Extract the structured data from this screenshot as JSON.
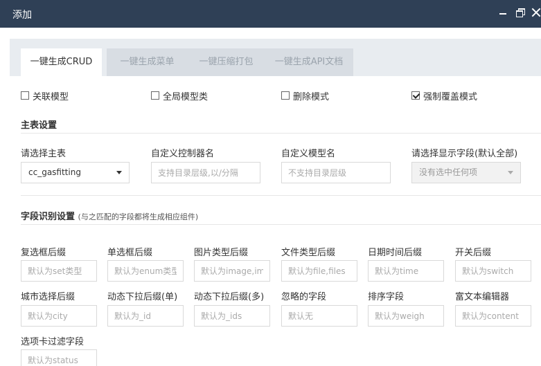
{
  "window": {
    "title": "添加"
  },
  "tabs": [
    {
      "label": "一键生成CRUD",
      "active": true
    },
    {
      "label": "一键生成菜单",
      "active": false
    },
    {
      "label": "一键压缩打包",
      "active": false
    },
    {
      "label": "一键生成API文档",
      "active": false
    }
  ],
  "options": [
    {
      "label": "关联模型",
      "checked": false
    },
    {
      "label": "全局模型类",
      "checked": false
    },
    {
      "label": "删除模式",
      "checked": false
    },
    {
      "label": "强制覆盖模式",
      "checked": true
    }
  ],
  "main_table_section": {
    "title": "主表设置",
    "main_table": {
      "label": "请选择主表",
      "value": "cc_gasfitting"
    },
    "controller": {
      "label": "自定义控制器名",
      "placeholder": "支持目录层级,以/分隔"
    },
    "model": {
      "label": "自定义模型名",
      "placeholder": "不支持目录层级"
    },
    "display_fields": {
      "label": "请选择显示字段(默认全部)",
      "value": "没有选中任何项"
    }
  },
  "field_section": {
    "title": "字段识别设置",
    "note": "(与之匹配的字段都将生成相应组件)",
    "fields": [
      {
        "label": "复选框后缀",
        "placeholder": "默认为set类型"
      },
      {
        "label": "单选框后缀",
        "placeholder": "默认为enum类型"
      },
      {
        "label": "图片类型后缀",
        "placeholder": "默认为image,images"
      },
      {
        "label": "文件类型后缀",
        "placeholder": "默认为file,files"
      },
      {
        "label": "日期时间后缀",
        "placeholder": "默认为time"
      },
      {
        "label": "开关后缀",
        "placeholder": "默认为switch"
      },
      {
        "label": "城市选择后缀",
        "placeholder": "默认为city"
      },
      {
        "label": "动态下拉后缀(单)",
        "placeholder": "默认为_id"
      },
      {
        "label": "动态下拉后缀(多)",
        "placeholder": "默认为_ids"
      },
      {
        "label": "忽略的字段",
        "placeholder": "默认无"
      },
      {
        "label": "排序字段",
        "placeholder": "默认为weigh"
      },
      {
        "label": "富文本编辑器",
        "placeholder": "默认为content"
      },
      {
        "label": "选项卡过滤字段",
        "placeholder": "默认为status"
      }
    ]
  }
}
